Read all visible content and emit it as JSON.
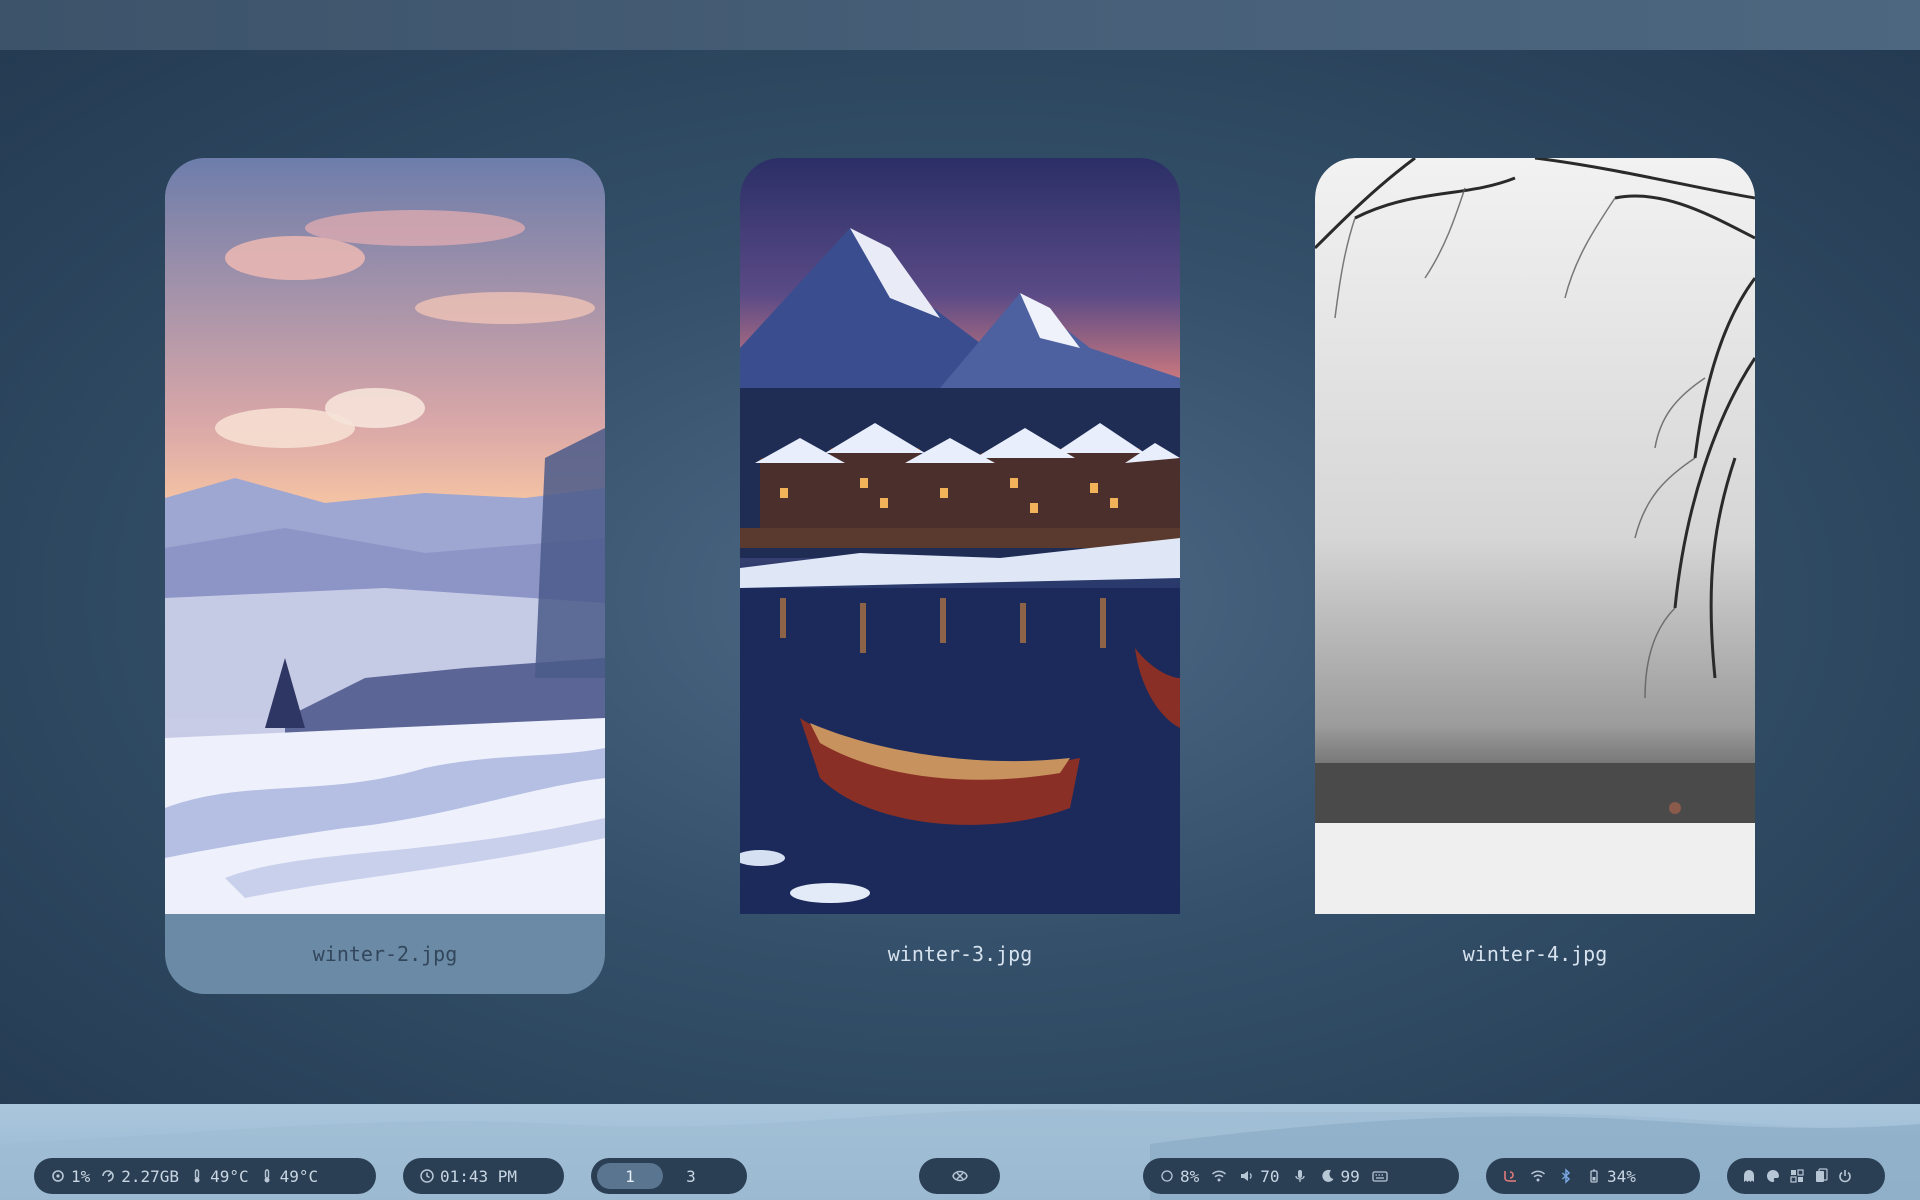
{
  "wallpaper_selector": {
    "cards": [
      {
        "filename": "winter-2.jpg",
        "selected": true
      },
      {
        "filename": "winter-3.jpg",
        "selected": false
      },
      {
        "filename": "winter-4.jpg",
        "selected": false
      }
    ]
  },
  "bar": {
    "system": {
      "cpu": "1%",
      "memory": "2.27GB",
      "temp1": "49°C",
      "temp2": "49°C"
    },
    "clock": {
      "time": "01:43 PM"
    },
    "workspaces": {
      "active": "1",
      "other": "3"
    },
    "controls": {
      "brightness": "8%",
      "volume": "70",
      "mic_level": "99"
    },
    "status": {
      "battery": "34%"
    }
  },
  "colors": {
    "accent": "#5a7590",
    "pill_bg": "#2b3f54",
    "selected_card": "#6a8aa6"
  }
}
